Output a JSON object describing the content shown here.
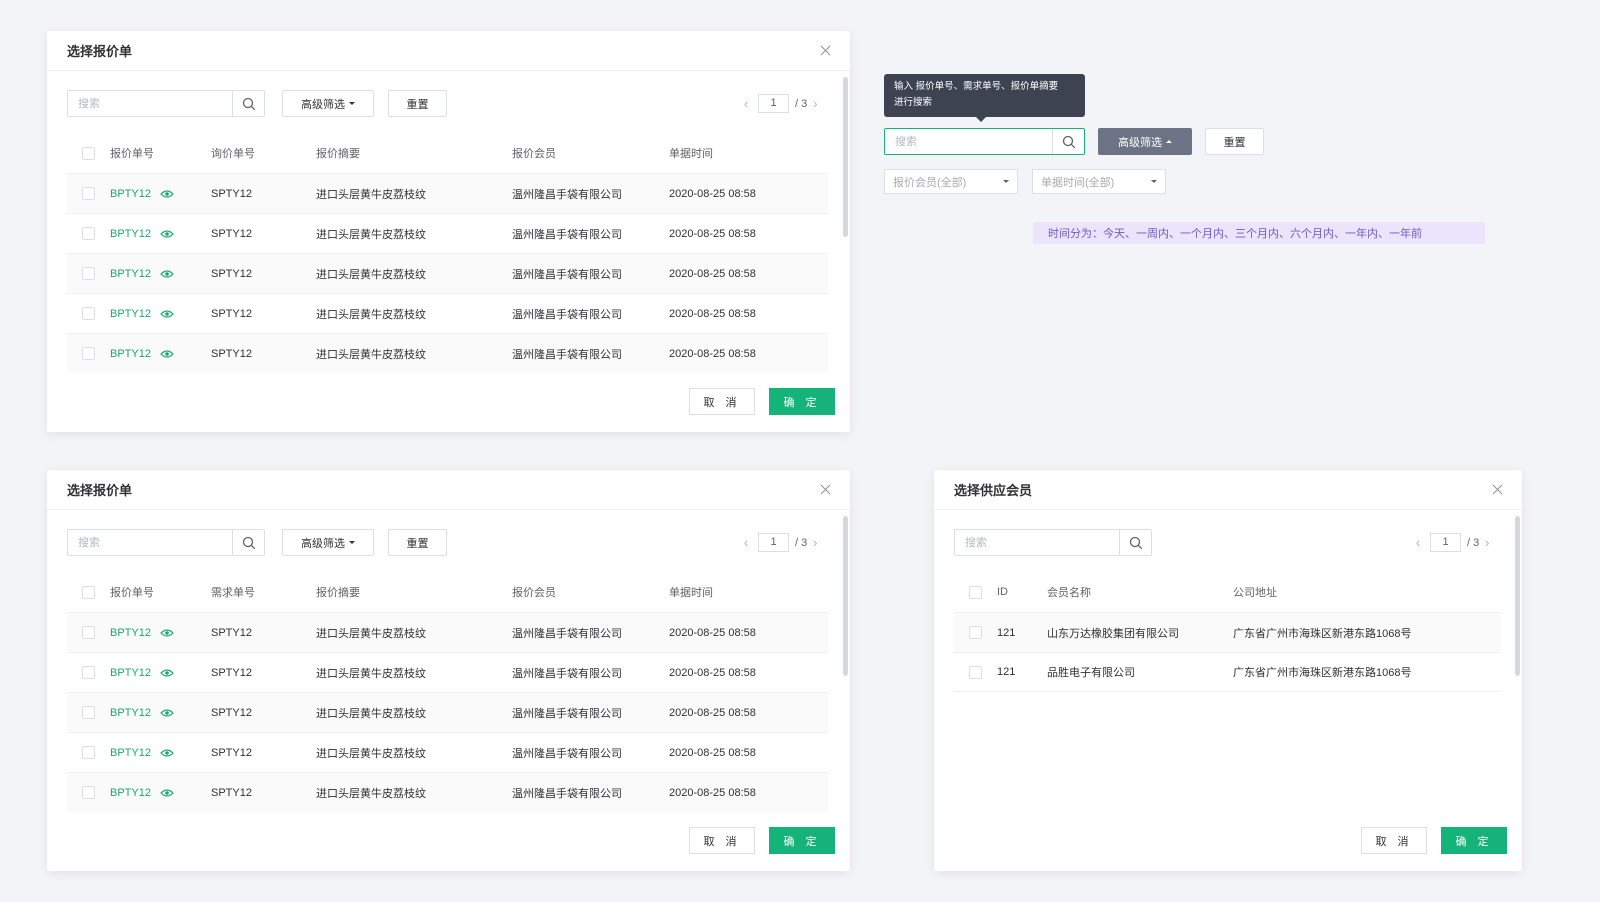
{
  "dialog_quote": {
    "title": "选择报价单",
    "search_placeholder": "搜索",
    "advanced_filter_label": "高级筛选",
    "reset_label": "重置",
    "page_current": "1",
    "page_total": "/ 3",
    "columns": [
      "报价单号",
      "询价单号",
      "报价摘要",
      "报价会员",
      "单据时间"
    ],
    "cancel_label": "取 消",
    "confirm_label": "确 定",
    "rows": [
      {
        "code": "BPTY12",
        "ref": "SPTY12",
        "summary": "进口头层黄牛皮荔枝纹",
        "member": "温州隆昌手袋有限公司",
        "time": "2020-08-25 08:58"
      },
      {
        "code": "BPTY12",
        "ref": "SPTY12",
        "summary": "进口头层黄牛皮荔枝纹",
        "member": "温州隆昌手袋有限公司",
        "time": "2020-08-25 08:58"
      },
      {
        "code": "BPTY12",
        "ref": "SPTY12",
        "summary": "进口头层黄牛皮荔枝纹",
        "member": "温州隆昌手袋有限公司",
        "time": "2020-08-25 08:58"
      },
      {
        "code": "BPTY12",
        "ref": "SPTY12",
        "summary": "进口头层黄牛皮荔枝纹",
        "member": "温州隆昌手袋有限公司",
        "time": "2020-08-25 08:58"
      },
      {
        "code": "BPTY12",
        "ref": "SPTY12",
        "summary": "进口头层黄牛皮荔枝纹",
        "member": "温州隆昌手袋有限公司",
        "time": "2020-08-25 08:58"
      }
    ]
  },
  "dialog_quote_2": {
    "title": "选择报价单",
    "search_placeholder": "搜索",
    "advanced_filter_label": "高级筛选",
    "reset_label": "重置",
    "page_current": "1",
    "page_total": "/ 3",
    "columns": [
      "报价单号",
      "需求单号",
      "报价摘要",
      "报价会员",
      "单据时间"
    ],
    "cancel_label": "取 消",
    "confirm_label": "确 定",
    "rows": [
      {
        "code": "BPTY12",
        "ref": "SPTY12",
        "summary": "进口头层黄牛皮荔枝纹",
        "member": "温州隆昌手袋有限公司",
        "time": "2020-08-25 08:58"
      },
      {
        "code": "BPTY12",
        "ref": "SPTY12",
        "summary": "进口头层黄牛皮荔枝纹",
        "member": "温州隆昌手袋有限公司",
        "time": "2020-08-25 08:58"
      },
      {
        "code": "BPTY12",
        "ref": "SPTY12",
        "summary": "进口头层黄牛皮荔枝纹",
        "member": "温州隆昌手袋有限公司",
        "time": "2020-08-25 08:58"
      },
      {
        "code": "BPTY12",
        "ref": "SPTY12",
        "summary": "进口头层黄牛皮荔枝纹",
        "member": "温州隆昌手袋有限公司",
        "time": "2020-08-25 08:58"
      },
      {
        "code": "BPTY12",
        "ref": "SPTY12",
        "summary": "进口头层黄牛皮荔枝纹",
        "member": "温州隆昌手袋有限公司",
        "time": "2020-08-25 08:58"
      }
    ]
  },
  "dialog_supplier": {
    "title": "选择供应会员",
    "search_placeholder": "搜索",
    "page_current": "1",
    "page_total": "/ 3",
    "columns": [
      "ID",
      "会员名称",
      "公司地址"
    ],
    "cancel_label": "取 消",
    "confirm_label": "确 定",
    "rows": [
      {
        "id": "121",
        "name": "山东万达橡胶集团有限公司",
        "address": "广东省广州市海珠区新港东路1068号"
      },
      {
        "id": "121",
        "name": "品胜电子有限公司",
        "address": "广东省广州市海珠区新港东路1068号"
      }
    ]
  },
  "filter_panel": {
    "tooltip_line1": "输入 报价单号、需求单号、报价单摘要",
    "tooltip_line2": "进行搜索",
    "search_placeholder": "搜索",
    "advanced_filter_label": "高级筛选",
    "reset_label": "重置",
    "member_select": "报价会员(全部)",
    "time_select": "单据时间(全部)",
    "time_note": "时间分为：今天、一周内、一个月内、三个月内、六个月内、一年内、一年前"
  },
  "colors": {
    "accent_green": "#15b37a",
    "link_green": "#19a86c",
    "active_filter_bg": "#6b7385",
    "note_bg": "#ebe4fb"
  }
}
